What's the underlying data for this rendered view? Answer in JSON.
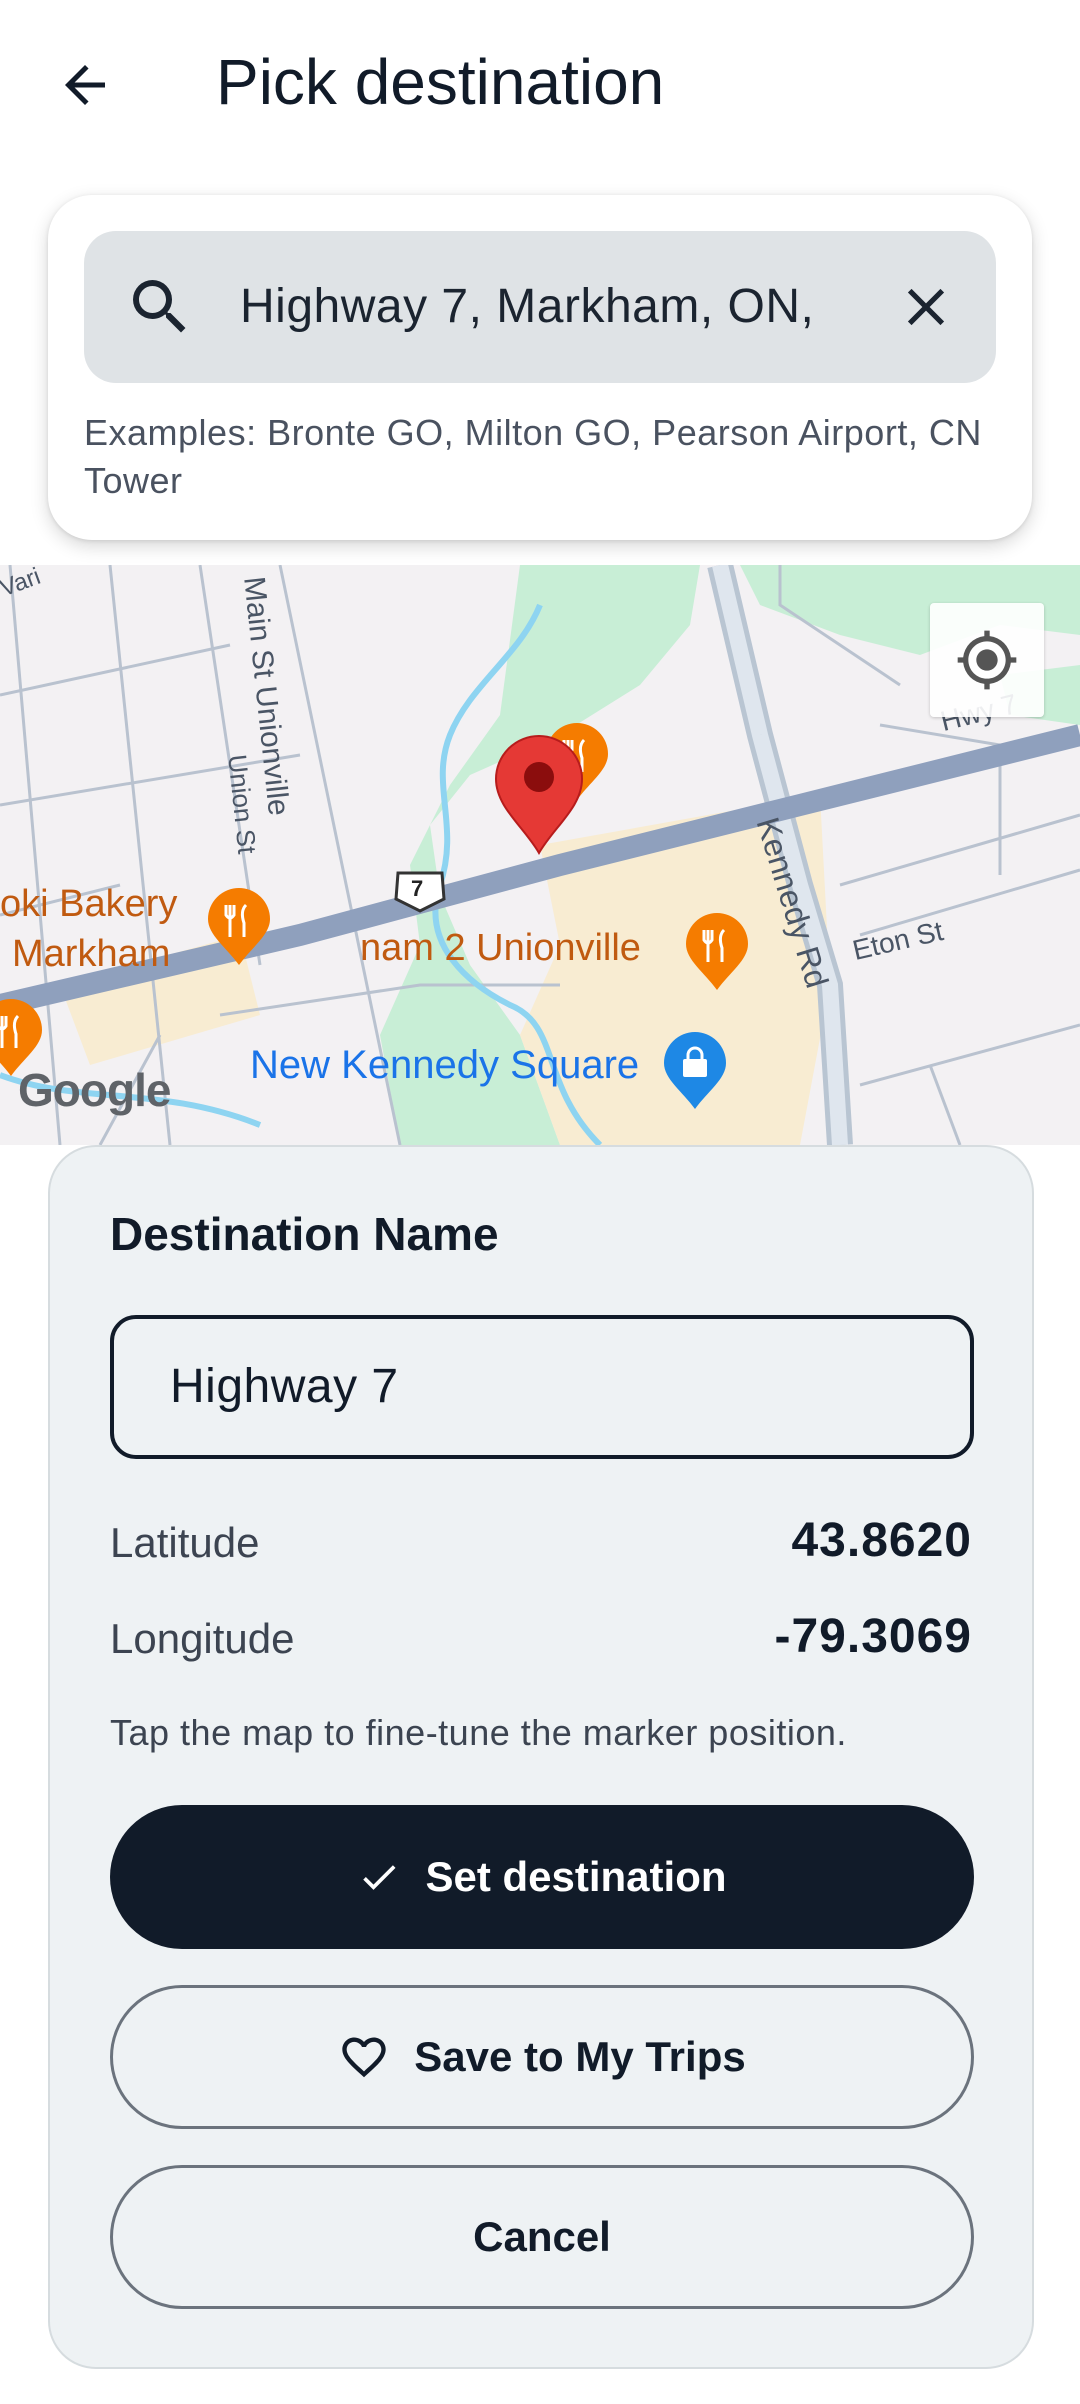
{
  "header": {
    "title": "Pick destination"
  },
  "search": {
    "value": "Highway 7, Markham, ON,",
    "examples": "Examples: Bronte GO, Milton GO, Pearson Airport, CN Tower"
  },
  "map": {
    "labels": {
      "main_st": "Main St Unionville",
      "union_st": "Union St",
      "kennedy_rd": "Kennedy Rd",
      "eton_st": "Eton St",
      "hwy7": "Hwy 7",
      "route_shield": "7",
      "bakery": "oki Bakery",
      "bakery_city": "Markham",
      "restaurant": "nam 2 Unionville",
      "shopping": "New Kennedy Square",
      "top_left": "Vari",
      "google": "Google"
    },
    "icons": {
      "pin": "map-pin-icon",
      "locate": "my-location-icon",
      "restaurant": "restaurant-icon",
      "shopping": "shopping-bag-icon"
    },
    "colors": {
      "pin": "#e53935",
      "poi_orange": "#f57c00",
      "poi_blue": "#1e88e5",
      "park": "#c8eed6",
      "water": "#8ed4f1",
      "road_major": "#8fa0bd",
      "commercial": "#f8ecd2"
    }
  },
  "details": {
    "section_title": "Destination Name",
    "name_value": "Highway 7",
    "latitude_label": "Latitude",
    "latitude_value": "43.8620",
    "longitude_label": "Longitude",
    "longitude_value": "-79.3069",
    "hint": "Tap the map to fine-tune the marker position."
  },
  "buttons": {
    "set_destination": "Set destination",
    "save_trips": "Save to My Trips",
    "cancel": "Cancel"
  }
}
